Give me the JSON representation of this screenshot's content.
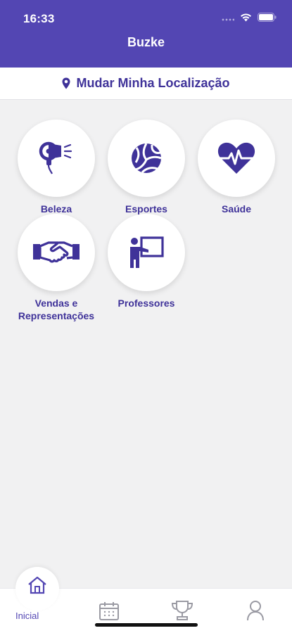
{
  "status": {
    "time": "16:33"
  },
  "header": {
    "title": "Buzke"
  },
  "location": {
    "label": "Mudar Minha Localização",
    "icon": "location-pin-icon"
  },
  "categories": [
    {
      "label": "Beleza",
      "icon": "hair-dryer-icon"
    },
    {
      "label": "Esportes",
      "icon": "volleyball-icon"
    },
    {
      "label": "Saúde",
      "icon": "heart-pulse-icon"
    },
    {
      "label": "Vendas e Representações",
      "icon": "handshake-icon"
    },
    {
      "label": "Professores",
      "icon": "teacher-board-icon"
    }
  ],
  "tabbar": {
    "items": [
      {
        "label": "Inicial",
        "icon": "home-icon",
        "active": true
      },
      {
        "label": "",
        "icon": "calendar-icon",
        "active": false
      },
      {
        "label": "",
        "icon": "trophy-icon",
        "active": false
      },
      {
        "label": "",
        "icon": "user-icon",
        "active": false
      }
    ]
  },
  "colors": {
    "primary": "#5346b3",
    "accent_text": "#3f3299",
    "background": "#f1f1f2"
  }
}
